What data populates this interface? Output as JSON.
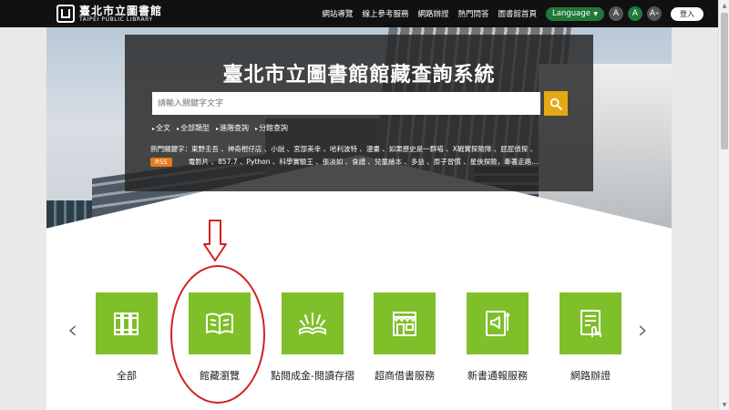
{
  "header": {
    "logo_zh": "臺北市立圖書館",
    "logo_en": "TAIPEI PUBLIC LIBRARY",
    "nav": [
      "網站導覽",
      "線上參考服務",
      "網路辦證",
      "熱門問答",
      "圖書館首頁"
    ],
    "language_label": "Language",
    "font_small": "A",
    "font_medium": "A",
    "font_large": "A",
    "font_large_sup": "+",
    "login_label": "登入"
  },
  "hero": {
    "title": "臺北市立圖書館館藏查詢系統",
    "search_placeholder": "請輸入關鍵字文字",
    "filters": [
      "全文",
      "全部類型",
      "進階查詢",
      "分館查詢"
    ],
    "hot_line1": "熱門關鍵字：東野圭吾 、神奇柑仔店 、小說 、宮部美幸 、哈利波特 、漫畫 、如果歷史是一群喵 、X戰實探險隊 、屁屁偵探 、",
    "rss_label": "RSS",
    "hot_line2": "電影片 、857.7 、Python 、科學實驗王 、張淡如 、食譜 、兒童繪本 、多益 、原子習慣 、星俠探險，牽著走路..."
  },
  "services": [
    {
      "label": "全部",
      "icon": "books-icon"
    },
    {
      "label": "館藏瀏覽",
      "icon": "open-book-icon"
    },
    {
      "label": "點閱成金-閱讀存摺",
      "icon": "sparkle-book-icon"
    },
    {
      "label": "超商借書服務",
      "icon": "store-icon"
    },
    {
      "label": "新書通報服務",
      "icon": "announcement-icon"
    },
    {
      "label": "網路辦證",
      "icon": "touch-card-icon"
    }
  ],
  "colors": {
    "topbar": "#111111",
    "accent_green": "#7fbf2a",
    "search_button": "#e6a817",
    "annotation_red": "#d42020",
    "rss": "#e87b1a"
  }
}
